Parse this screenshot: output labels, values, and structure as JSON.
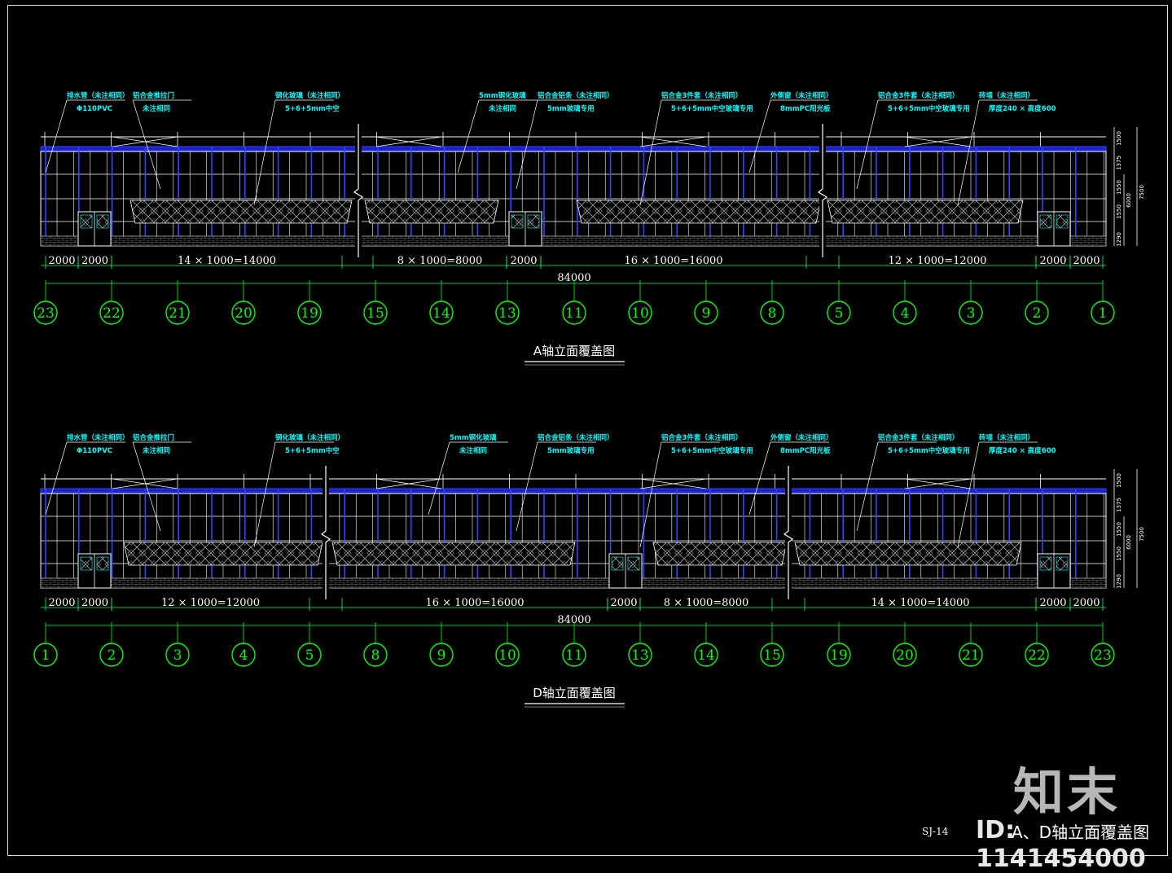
{
  "drawings": [
    {
      "title": "A轴立面覆盖图",
      "axes": [
        "23",
        "22",
        "21",
        "20",
        "19",
        "15",
        "14",
        "13",
        "11",
        "10",
        "9",
        "8",
        "5",
        "4",
        "3",
        "2",
        "1"
      ],
      "dims": [
        "2000",
        "2000",
        "14 × 1000=14000",
        "8 × 1000=8000",
        "2000",
        "16 × 1000=16000",
        "12 × 1000=12000",
        "2000",
        "2000"
      ],
      "total": "84000",
      "right_dims": [
        "1500",
        "1375",
        "1550",
        "1550",
        "1290",
        "6000",
        "7500"
      ],
      "callouts": [
        {
          "l1": "排水管（未注相同）",
          "l2": "Φ110PVC"
        },
        {
          "l1": "铝合金推拉门",
          "l2": "未注相同"
        },
        {
          "l1": "钢化玻璃（未注相同）",
          "l2": "5+6+5mm中空"
        },
        {
          "l1": "5mm钢化玻璃",
          "l2": "未注相同"
        },
        {
          "l1": "铝合金铝条（未注相同）",
          "l2": "5mm玻璃专用"
        },
        {
          "l1": "铝合金3件套（未注相同）",
          "l2": "5+6+5mm中空玻璃专用"
        },
        {
          "l1": "外侧窗（未注相同）",
          "l2": "8mmPC阳光板"
        },
        {
          "l1": "铝合金3件套（未注相同）",
          "l2": "5+6+5mm中空玻璃专用"
        },
        {
          "l1": "砖墙（未注相同）",
          "l2": "厚度240 × 高度600"
        }
      ]
    },
    {
      "title": "D轴立面覆盖图",
      "axes": [
        "1",
        "2",
        "3",
        "4",
        "5",
        "8",
        "9",
        "10",
        "11",
        "13",
        "14",
        "15",
        "19",
        "20",
        "21",
        "22",
        "23"
      ],
      "dims": [
        "2000",
        "2000",
        "12 × 1000=12000",
        "16 × 1000=16000",
        "2000",
        "8 × 1000=8000",
        "14 × 1000=14000",
        "2000",
        "2000"
      ],
      "total": "84000",
      "right_dims": [
        "1500",
        "1375",
        "1550",
        "1550",
        "1290",
        "6000",
        "7500"
      ],
      "callouts": [
        {
          "l1": "排水管（未注相同）",
          "l2": "Φ110PVC"
        },
        {
          "l1": "铝合金推拉门",
          "l2": "未注相同"
        },
        {
          "l1": "钢化玻璃（未注相同）",
          "l2": "5+6+5mm中空"
        },
        {
          "l1": "5mm钢化玻璃",
          "l2": "未注相同"
        },
        {
          "l1": "铝合金铝条（未注相同）",
          "l2": "5mm玻璃专用"
        },
        {
          "l1": "铝合金3件套（未注相同）",
          "l2": "5+6+5mm中空玻璃专用"
        },
        {
          "l1": "外侧窗（未注相同）",
          "l2": "8mmPC阳光板"
        },
        {
          "l1": "铝合金3件套（未注相同）",
          "l2": "5+6+5mm中空玻璃专用"
        },
        {
          "l1": "砖墙（未注相同）",
          "l2": "厚度240 × 高度600"
        }
      ]
    }
  ],
  "sheet_no": "SJ-14",
  "sheet_title": "A、D轴立面覆盖图",
  "watermark_logo": "知末",
  "watermark_id": "ID: 1141454000",
  "colors": {
    "background": "#000000",
    "axis": "#00ff00",
    "frame": "#ffffff",
    "column": "#3344ff",
    "hatch": "#a0a0a0",
    "annotation": "#00ffff",
    "dimension": "#00ff66"
  }
}
